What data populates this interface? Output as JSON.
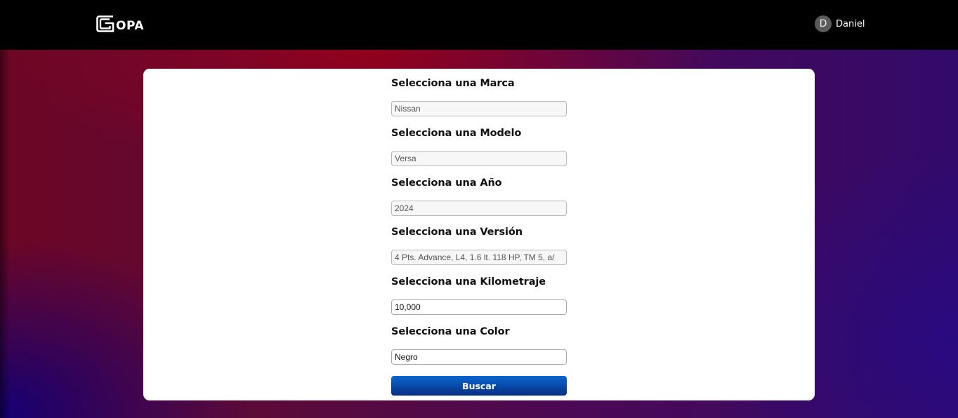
{
  "header": {
    "logo_text": "OPA",
    "user": {
      "avatar_initial": "D",
      "name": "Daniel"
    }
  },
  "form": {
    "fields": [
      {
        "label": "Selecciona una Marca",
        "value": "Nissan",
        "active": false
      },
      {
        "label": "Selecciona una Modelo",
        "value": "Versa",
        "active": false
      },
      {
        "label": "Selecciona una Año",
        "value": "2024",
        "active": false
      },
      {
        "label": "Selecciona una Versión",
        "value": "4 Pts. Advance, L4, 1.6 lt. 118 HP, TM 5, a/",
        "active": false
      },
      {
        "label": "Selecciona una Kilometraje",
        "value": "10,000",
        "active": true
      },
      {
        "label": "Selecciona una Color",
        "value": "Negro",
        "active": true
      }
    ],
    "submit_label": "Buscar"
  },
  "colors": {
    "header_bg": "#000000",
    "button_blue": "#0848a6",
    "background_red": "#960019",
    "background_blue": "#0f0078"
  }
}
